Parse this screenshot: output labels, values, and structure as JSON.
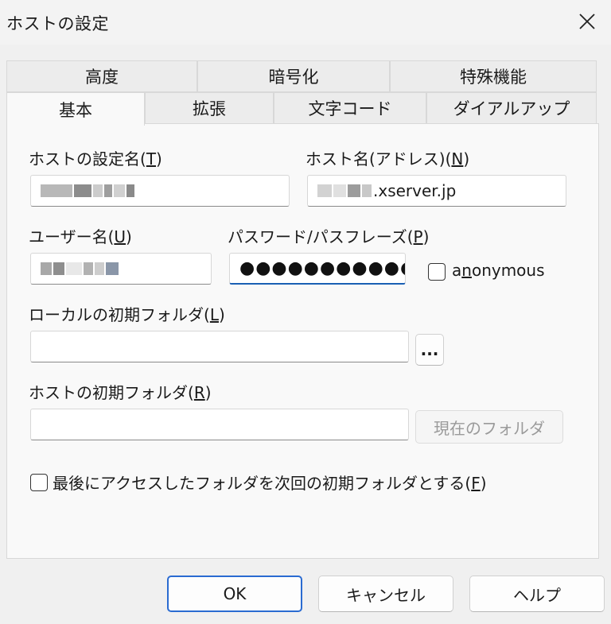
{
  "window": {
    "title": "ホストの設定",
    "close_icon": "close-icon"
  },
  "tabs": {
    "row1": [
      "高度",
      "暗号化",
      "特殊機能"
    ],
    "row2": [
      "基本",
      "拡張",
      "文字コード",
      "ダイアルアップ"
    ],
    "active": "基本"
  },
  "form": {
    "host_setting_name": {
      "label": "ホストの設定名(",
      "accel": "T",
      "close": ")"
    },
    "host_name": {
      "label": "ホスト名(アドレス)(",
      "accel": "N",
      "close": ")",
      "value_suffix": ".xserver.jp"
    },
    "user_name": {
      "label": "ユーザー名(",
      "accel": "U",
      "close": ")"
    },
    "password": {
      "label": "パスワード/パスフレーズ(",
      "accel": "P",
      "close": ")",
      "masked": "●●●●●●●●●●●"
    },
    "anonymous": {
      "label_pre": "a",
      "accel": "n",
      "label_post": "onymous",
      "checked": false
    },
    "local_dir": {
      "label": "ローカルの初期フォルダ(",
      "accel": "L",
      "close": ")",
      "browse_label": "...",
      "value": ""
    },
    "host_dir": {
      "label": "ホストの初期フォルダ(",
      "accel": "R",
      "close": ")",
      "current_folder_label": "現在のフォルダ",
      "value": ""
    },
    "last_folder": {
      "label": "最後にアクセスしたフォルダを次回の初期フォルダとする(",
      "accel": "F",
      "close": ")",
      "checked": false
    }
  },
  "buttons": {
    "ok": "OK",
    "cancel": "キャンセル",
    "help": "ヘルプ"
  },
  "colors": {
    "accent": "#2a6bd1",
    "focus_underline": "#1a5fb4"
  }
}
